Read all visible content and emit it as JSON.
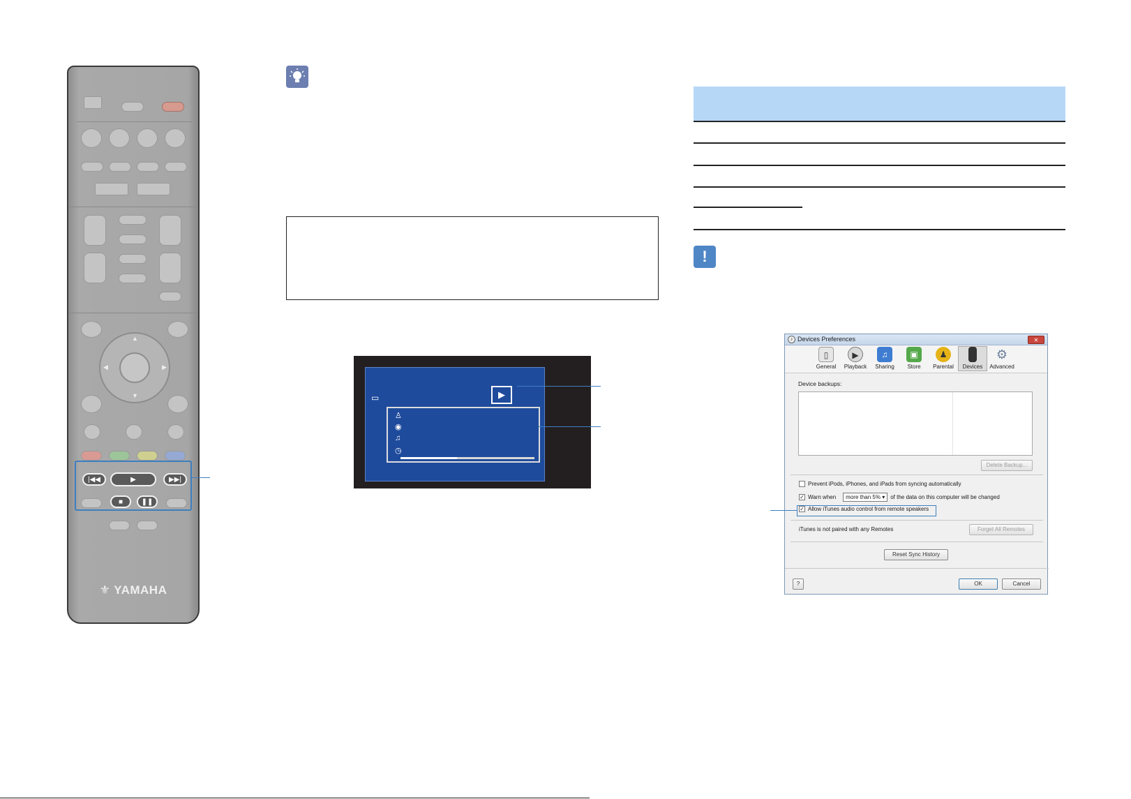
{
  "remote": {
    "brand": "YAMAHA"
  },
  "icons": {
    "hint": "lightbulb-icon",
    "caution": "exclamation-icon",
    "airplay": "airplay-icon"
  },
  "colors": {
    "accent_blue": "#3d7fc0",
    "table_header": "#b7d7f7",
    "tv_screen": "#1f4b9c"
  },
  "tv_screen": {
    "progress": 0.42
  },
  "itunes_window": {
    "title": "Devices Preferences",
    "close_label": "✕",
    "tabs": [
      {
        "label": "General"
      },
      {
        "label": "Playback"
      },
      {
        "label": "Sharing"
      },
      {
        "label": "Store"
      },
      {
        "label": "Parental"
      },
      {
        "label": "Devices",
        "active": true
      },
      {
        "label": "Advanced"
      }
    ],
    "device_backups_label": "Device backups:",
    "delete_backup_button": "Delete Backup...",
    "prevent_sync_label": "Prevent iPods, iPhones, and iPads from syncing automatically",
    "warn_when_label": "Warn when",
    "warn_select_value": "more than 5%",
    "warn_suffix": "of the data on this computer will be changed",
    "allow_remote_label": "Allow iTunes audio control from remote speakers",
    "remotes_status": "iTunes is not paired with any Remotes",
    "forget_remotes_button": "Forget All Remotes",
    "reset_sync_button": "Reset Sync History",
    "help_button": "?",
    "ok_button": "OK",
    "cancel_button": "Cancel"
  }
}
